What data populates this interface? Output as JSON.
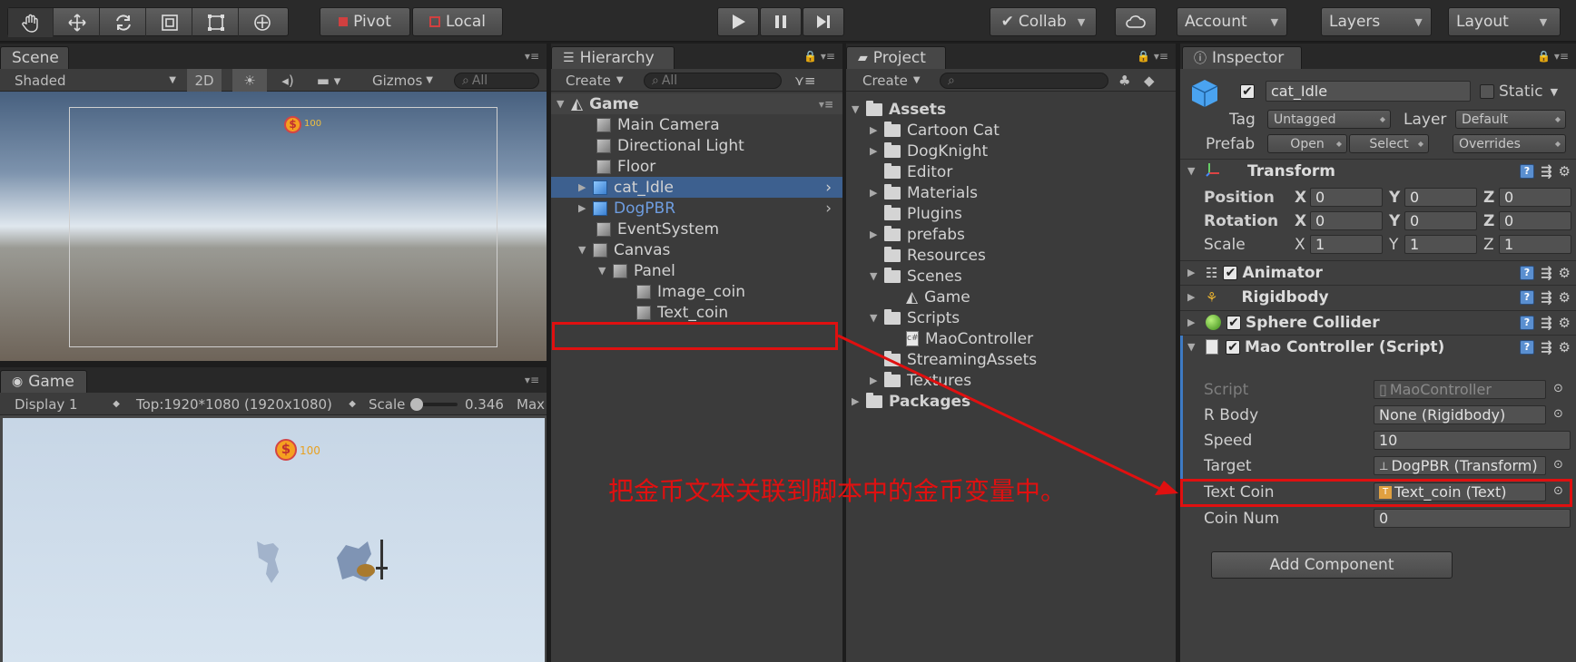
{
  "toolbar": {
    "pivot_label": "Pivot",
    "local_label": "Local",
    "collab_label": "Collab",
    "account_label": "Account",
    "layers_label": "Layers",
    "layout_label": "Layout"
  },
  "scene": {
    "tab_label": "Scene",
    "shading": "Shaded",
    "mode_2d": "2D",
    "gizmos": "Gizmos",
    "search_placeholder": "All",
    "coin_text": "100"
  },
  "game": {
    "tab_label": "Game",
    "display": "Display 1",
    "resolution": "Top:1920*1080 (1920x1080)",
    "scale_label": "Scale",
    "scale_value": "0.346",
    "max_label": "Max",
    "coin_text": "100"
  },
  "hierarchy": {
    "tab_label": "Hierarchy",
    "create_label": "Create",
    "search_placeholder": "All",
    "scene_name": "Game",
    "items": [
      {
        "label": "Main Camera"
      },
      {
        "label": "Directional Light"
      },
      {
        "label": "Floor"
      },
      {
        "label": "cat_Idle"
      },
      {
        "label": "DogPBR"
      },
      {
        "label": "EventSystem"
      },
      {
        "label": "Canvas"
      },
      {
        "label": "Panel"
      },
      {
        "label": "Image_coin"
      },
      {
        "label": "Text_coin"
      }
    ]
  },
  "project": {
    "tab_label": "Project",
    "create_label": "Create",
    "items": [
      {
        "label": "Assets"
      },
      {
        "label": "Cartoon Cat"
      },
      {
        "label": "DogKnight"
      },
      {
        "label": "Editor"
      },
      {
        "label": "Materials"
      },
      {
        "label": "Plugins"
      },
      {
        "label": "prefabs"
      },
      {
        "label": "Resources"
      },
      {
        "label": "Scenes"
      },
      {
        "label": "Game"
      },
      {
        "label": "Scripts"
      },
      {
        "label": "MaoController"
      },
      {
        "label": "StreamingAssets"
      },
      {
        "label": "Textures"
      },
      {
        "label": "Packages"
      }
    ]
  },
  "inspector": {
    "tab_label": "Inspector",
    "object_name": "cat_Idle",
    "static_label": "Static",
    "tag_label": "Tag",
    "tag_value": "Untagged",
    "layer_label": "Layer",
    "layer_value": "Default",
    "prefab_label": "Prefab",
    "open_label": "Open",
    "select_label": "Select",
    "overrides_label": "Overrides",
    "transform": {
      "title": "Transform",
      "position_label": "Position",
      "rotation_label": "Rotation",
      "scale_label": "Scale",
      "position": [
        "0",
        "0",
        "0"
      ],
      "rotation": [
        "0",
        "0",
        "0"
      ],
      "scale": [
        "1",
        "1",
        "1"
      ]
    },
    "animator_title": "Animator",
    "rigidbody_title": "Rigidbody",
    "sphere_collider_title": "Sphere Collider",
    "mao_controller": {
      "title": "Mao Controller (Script)",
      "script_label": "Script",
      "script_value": "MaoController",
      "rbody_label": "R Body",
      "rbody_value": "None (Rigidbody)",
      "speed_label": "Speed",
      "speed_value": "10",
      "target_label": "Target",
      "target_value": "DogPBR (Transform)",
      "textcoin_label": "Text Coin",
      "textcoin_value": "Text_coin (Text)",
      "coinnum_label": "Coin Num",
      "coinnum_value": "0"
    },
    "add_component_label": "Add Component"
  },
  "annotation": {
    "text": "把金币文本关联到脚本中的金币变量中。",
    "color": "#e01010"
  }
}
